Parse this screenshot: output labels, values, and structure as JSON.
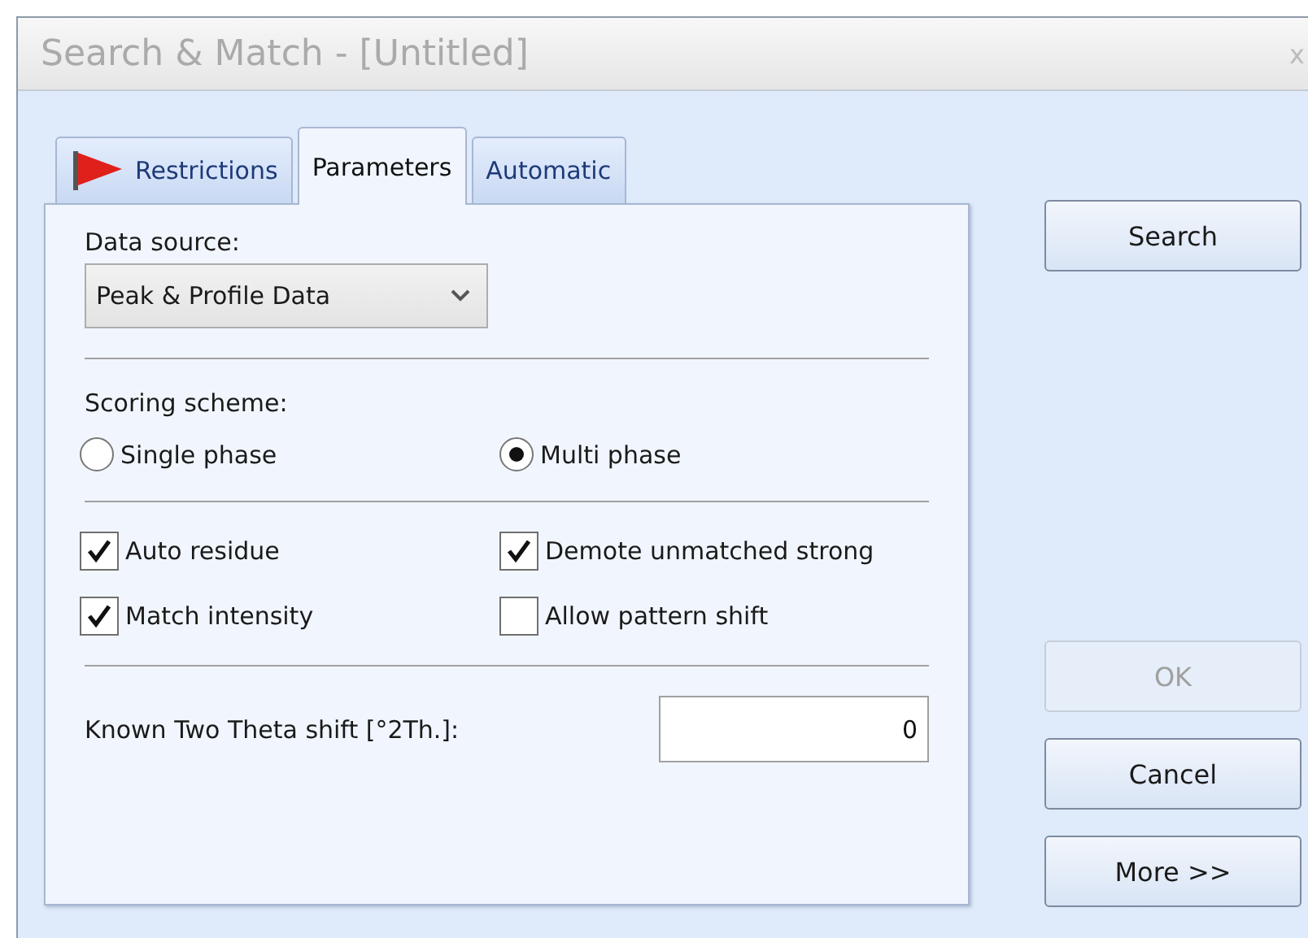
{
  "window": {
    "title": "Search & Match - [Untitled]",
    "close": "x"
  },
  "tabs": [
    {
      "label": "Restrictions",
      "selected": false,
      "flag": true
    },
    {
      "label": "Parameters",
      "selected": true,
      "flag": false
    },
    {
      "label": "Automatic",
      "selected": false,
      "flag": false
    }
  ],
  "data_source": {
    "label": "Data source:",
    "value": "Peak & Profile Data"
  },
  "scoring": {
    "label": "Scoring scheme:",
    "options": [
      {
        "label": "Single phase",
        "selected": false
      },
      {
        "label": "Multi phase",
        "selected": true
      }
    ]
  },
  "options": [
    {
      "label": "Auto residue",
      "checked": true
    },
    {
      "label": "Demote unmatched strong",
      "checked": true
    },
    {
      "label": "Match intensity",
      "checked": true
    },
    {
      "label": "Allow pattern shift",
      "checked": false
    }
  ],
  "shift": {
    "label": "Known Two Theta shift [°2Th.]:",
    "value": "0"
  },
  "buttons_top": [
    {
      "label": "Search",
      "disabled": false
    }
  ],
  "buttons_bottom": [
    {
      "label": "OK",
      "disabled": true
    },
    {
      "label": "Cancel",
      "disabled": false
    },
    {
      "label": "More >>",
      "disabled": false
    }
  ]
}
